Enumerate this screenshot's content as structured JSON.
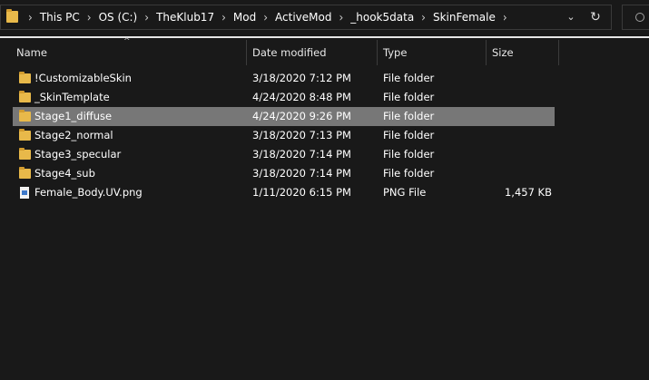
{
  "address_bar": {
    "crumbs": [
      "This PC",
      "OS (C:)",
      "TheKlub17",
      "Mod",
      "ActiveMod",
      "_hook5data",
      "SkinFemale"
    ],
    "dropdown_icon": "chevron-down-icon",
    "refresh_icon": "refresh-icon"
  },
  "search": {
    "icon": "search-icon"
  },
  "columns": {
    "name": "Name",
    "date": "Date modified",
    "type": "Type",
    "size": "Size"
  },
  "files": [
    {
      "name": "!CustomizableSkin",
      "date": "3/18/2020 7:12 PM",
      "type": "File folder",
      "size": "",
      "icon": "folder-icon",
      "selected": false
    },
    {
      "name": "_SkinTemplate",
      "date": "4/24/2020 8:48 PM",
      "type": "File folder",
      "size": "",
      "icon": "folder-icon",
      "selected": false
    },
    {
      "name": "Stage1_diffuse",
      "date": "4/24/2020 9:26 PM",
      "type": "File folder",
      "size": "",
      "icon": "folder-icon",
      "selected": true
    },
    {
      "name": "Stage2_normal",
      "date": "3/18/2020 7:13 PM",
      "type": "File folder",
      "size": "",
      "icon": "folder-icon",
      "selected": false
    },
    {
      "name": "Stage3_specular",
      "date": "3/18/2020 7:14 PM",
      "type": "File folder",
      "size": "",
      "icon": "folder-icon",
      "selected": false
    },
    {
      "name": "Stage4_sub",
      "date": "3/18/2020 7:14 PM",
      "type": "File folder",
      "size": "",
      "icon": "folder-icon",
      "selected": false
    },
    {
      "name": "Female_Body.UV.png",
      "date": "1/11/2020 6:15 PM",
      "type": "PNG File",
      "size": "1,457 KB",
      "icon": "png-file-icon",
      "selected": false
    }
  ],
  "colors": {
    "background": "#191919",
    "selected_row": "#777777",
    "folder": "#e8b94a"
  }
}
